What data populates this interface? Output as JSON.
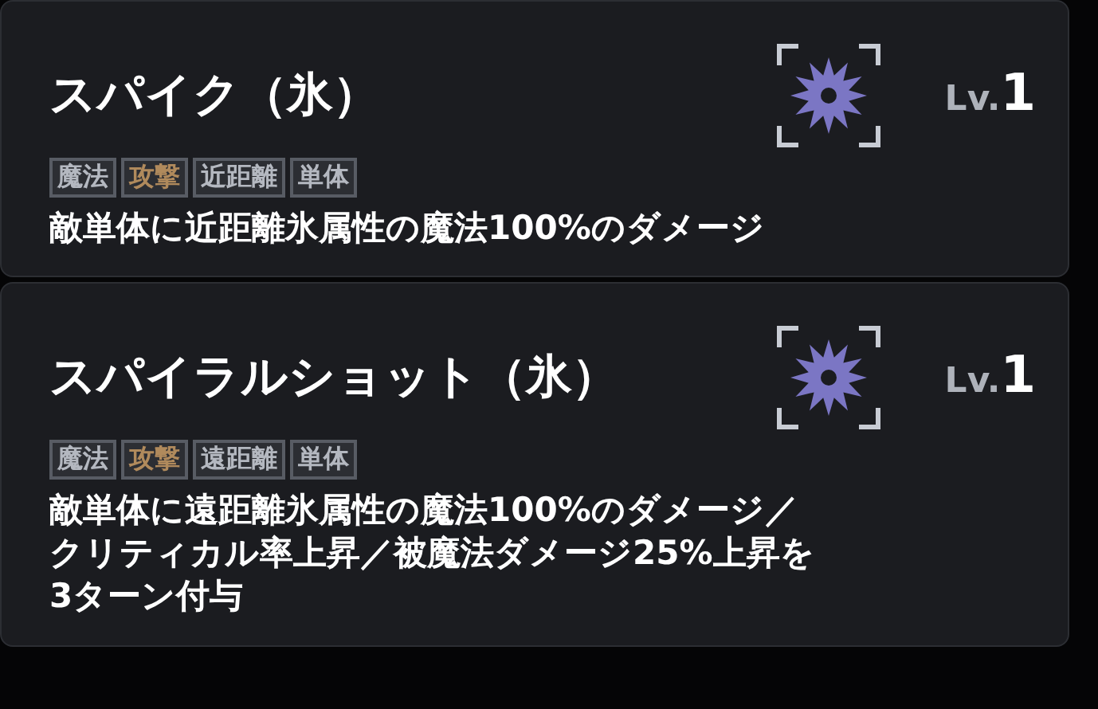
{
  "skills": [
    {
      "name": "スパイク（氷）",
      "level_label": "Lv.",
      "level": "1",
      "tags": [
        {
          "label": "魔法",
          "color": "#b4b8c0"
        },
        {
          "label": "攻撃",
          "color": "#b08a5c"
        },
        {
          "label": "近距離",
          "color": "#b4b8c0"
        },
        {
          "label": "単体",
          "color": "#b4b8c0"
        }
      ],
      "description": [
        "敵単体に近距離氷属性の魔法100%のダメージ"
      ]
    },
    {
      "name": "スパイラルショット（氷）",
      "level_label": "Lv.",
      "level": "1",
      "tags": [
        {
          "label": "魔法",
          "color": "#b4b8c0"
        },
        {
          "label": "攻撃",
          "color": "#b08a5c"
        },
        {
          "label": "遠距離",
          "color": "#b4b8c0"
        },
        {
          "label": "単体",
          "color": "#b4b8c0"
        }
      ],
      "description": [
        "敵単体に遠距離氷属性の魔法100%のダメージ／",
        "クリティカル率上昇／被魔法ダメージ25%上昇を",
        "3ターン付与"
      ]
    }
  ]
}
